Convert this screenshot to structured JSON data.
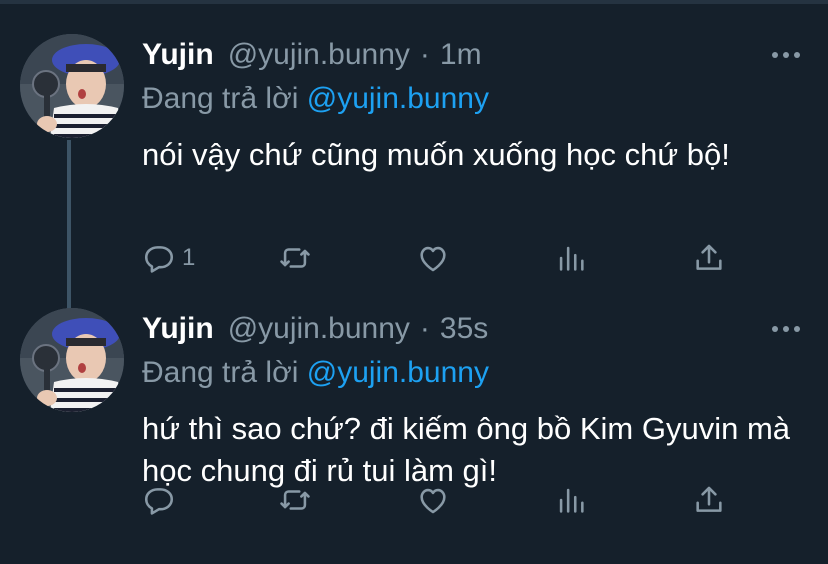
{
  "tweets": [
    {
      "name": "Yujin",
      "handle": "@yujin.bunny",
      "separator": "·",
      "time": "1m",
      "replying_prefix": "Đang trả lời",
      "replying_to": "@yujin.bunny",
      "text": "nói vậy chứ cũng muốn xuống học chứ bộ!",
      "reply_count": "1"
    },
    {
      "name": "Yujin",
      "handle": "@yujin.bunny",
      "separator": "·",
      "time": "35s",
      "replying_prefix": "Đang trả lời",
      "replying_to": "@yujin.bunny",
      "text": "hứ thì sao chứ? đi kiếm ông bồ Kim Gyuvin mà học chung đi rủ tui làm gì!",
      "reply_count": ""
    }
  ],
  "icons": {
    "reply": "reply-icon",
    "retweet": "retweet-icon",
    "like": "like-icon",
    "analytics": "analytics-icon",
    "share": "share-icon",
    "more": "more-icon"
  },
  "colors": {
    "background": "#15202b",
    "secondary_text": "#8899a6",
    "mention": "#1da1f2",
    "thread_line": "#3d5466"
  }
}
